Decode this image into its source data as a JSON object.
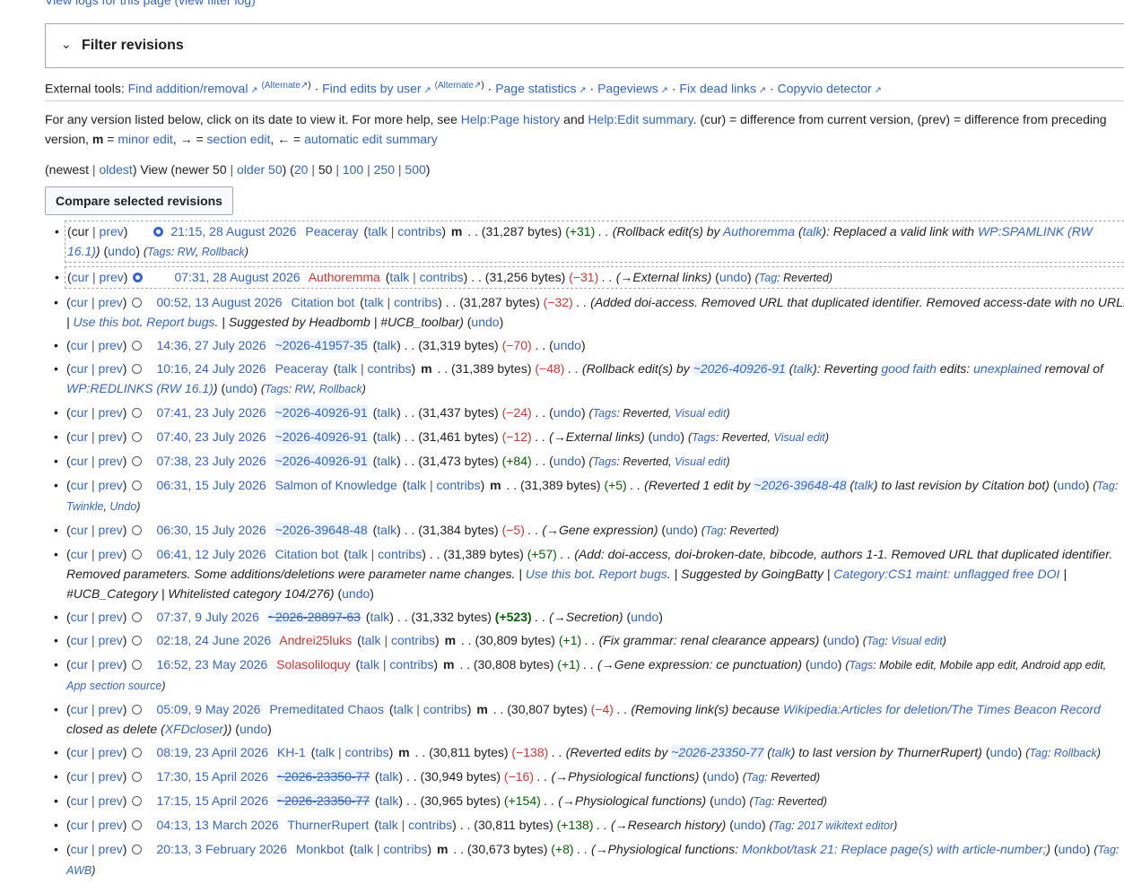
{
  "top_link": "View logs for this page (view filter log)",
  "filter": {
    "chevron": "⌄",
    "title": "Filter revisions"
  },
  "external": {
    "label": "External tools:",
    "find_addition": "Find addition/removal",
    "alternate1": "(Alternate",
    "alternate1_close": ")",
    "find_edits": "Find edits by user",
    "alternate2": "(Alternate",
    "alternate2_close": ")",
    "page_stats": "Page statistics",
    "pageviews": "Pageviews",
    "fix_dead": "Fix dead links",
    "copyvio": "Copyvio detector"
  },
  "help": {
    "t1": "For any version listed below, click on its date to view it. For more help, see ",
    "help_page_history": "Help:Page history",
    "t2": " and ",
    "help_edit_summary": "Help:Edit summary",
    "t3": ". (cur) = difference from current version, (prev) = difference from preceding version, ",
    "m": "m",
    "t4": " = ",
    "minor_edit": "minor edit",
    "t5": ", → = ",
    "section_edit": "section edit",
    "t6": ", ← = ",
    "auto_summary": "automatic edit summary"
  },
  "nav": {
    "newest": "(newest",
    "oldest": "oldest",
    "view": ") View (newer 50",
    "older50": "older 50",
    "close1": ") (",
    "n20": "20",
    "n50": "50",
    "n100": "100",
    "n250": "250",
    "n500": "500",
    "close2": ")"
  },
  "compare_button": "Compare selected revisions",
  "rows": [
    {
      "cur": "cur",
      "prev": "prev",
      "date": "21:15, 28 August 2026",
      "user": "Peaceray",
      "talk": "talk",
      "contribs": "contribs",
      "minor": "m",
      "bytes": ". . (31,287 bytes)",
      "diff": "(+31)",
      "summary": ". . (Rollback edit(s) by ",
      "s_link": "Authoremma",
      "s2": " (",
      "s_talk": "talk",
      "s3": "): Replaced a valid link with ",
      "s_link2": "WP:SPAMLINK (RW 16.1)",
      "s4": ")",
      "undo": "undo",
      "tags_label": "Tags",
      "tag1": "RW",
      "tag2": "Rollback"
    },
    {
      "cur": "cur",
      "prev": "prev",
      "date": "07:31, 28 August 2026",
      "user": "Authoremma",
      "talk": "talk",
      "contribs": "contribs",
      "bytes": ". . (31,256 bytes)",
      "diff": "(−31)",
      "summary": ". . (→External links)",
      "undo": "undo",
      "tags_label": "Tag",
      "tag_plain": "Reverted"
    },
    {
      "cur": "cur",
      "prev": "prev",
      "date": "00:52, 13 August 2026",
      "user": "Citation bot",
      "talk": "talk",
      "contribs": "contribs",
      "bytes": ". . (31,287 bytes)",
      "diff": "(−32)",
      "summary": ". . (Added doi-access. Removed URL that duplicated identifier. Removed access-date with no URL. ",
      "s_bar": "| ",
      "s_link": "Use this bot",
      "s2": ". ",
      "s_link2": "Report bugs",
      "s3": ". | Suggested by Headbomb | #UCB_toolbar)",
      "undo": "undo"
    },
    {
      "cur": "cur",
      "prev": "prev",
      "date": "14:36, 27 July 2026",
      "user": "~2026-41957-35",
      "talk": "talk",
      "bytes": ". . (31,319 bytes)",
      "diff": "(−70)",
      "undo": "undo"
    },
    {
      "cur": "cur",
      "prev": "prev",
      "date": "10:16, 24 July 2026",
      "user": "Peaceray",
      "talk": "talk",
      "contribs": "contribs",
      "minor": "m",
      "bytes": ". . (31,389 bytes)",
      "diff": "(−48)",
      "summary": ". . (Rollback edit(s) by ",
      "s_link": "~2026-40926-91",
      "s2": " (",
      "s_talk": "talk",
      "s3": "): Reverting ",
      "s_link2": "good faith",
      "s4": " edits: ",
      "s_link3": "unexplained",
      "s5": " removal of ",
      "s_link4": "WP:REDLINKS (RW 16.1)",
      "s6": ")",
      "undo": "undo",
      "tags_label": "Tags",
      "tag1": "RW",
      "tag2": "Rollback"
    },
    {
      "cur": "cur",
      "prev": "prev",
      "date": "07:41, 23 July 2026",
      "user": "~2026-40926-91",
      "talk": "talk",
      "bytes": ". . (31,437 bytes)",
      "diff": "(−24)",
      "undo": "undo",
      "tags_label": "Tags",
      "tag_plain": "Reverted",
      "tag1": "Visual edit"
    },
    {
      "cur": "cur",
      "prev": "prev",
      "date": "07:40, 23 July 2026",
      "user": "~2026-40926-91",
      "talk": "talk",
      "bytes": ". . (31,461 bytes)",
      "diff": "(−12)",
      "summary": ". . (→External links)",
      "undo": "undo",
      "tags_label": "Tags",
      "tag_plain": "Reverted",
      "tag1": "Visual edit"
    },
    {
      "cur": "cur",
      "prev": "prev",
      "date": "07:38, 23 July 2026",
      "user": "~2026-40926-91",
      "talk": "talk",
      "bytes": ". . (31,473 bytes)",
      "diff": "(+84)",
      "undo": "undo",
      "tags_label": "Tags",
      "tag_plain": "Reverted",
      "tag1": "Visual edit"
    },
    {
      "cur": "cur",
      "prev": "prev",
      "date": "06:31, 15 July 2026",
      "user": "Salmon of Knowledge",
      "talk": "talk",
      "contribs": "contribs",
      "minor": "m",
      "bytes": ". . (31,389 bytes)",
      "diff": "(+5)",
      "summary": ". . (Reverted 1 edit by ",
      "s_link": "~2026-39648-48",
      "s2": " (",
      "s_talk": "talk",
      "s3": ") to last revision by Citation bot)",
      "undo": "undo",
      "tags_label": "Tag",
      "tag1": "Twinkle",
      "tag2": "Undo"
    },
    {
      "cur": "cur",
      "prev": "prev",
      "date": "06:30, 15 July 2026",
      "user": "~2026-39648-48",
      "talk": "talk",
      "bytes": ". . (31,384 bytes)",
      "diff": "(−5)",
      "summary": ". . (→Gene expression)",
      "undo": "undo",
      "tags_label": "Tag",
      "tag_plain": "Reverted"
    },
    {
      "cur": "cur",
      "prev": "prev",
      "date": "06:41, 12 July 2026",
      "user": "Citation bot",
      "talk": "talk",
      "contribs": "contribs",
      "bytes": ". . (31,389 bytes)",
      "diff": "(+57)",
      "summary": ". . (Add: doi-access, doi-broken-date, bibcode, authors 1-1. Removed URL that duplicated identifier. Removed parameters. Some additions/deletions were parameter name changes. | ",
      "s_link": "Use this bot",
      "s2": ". ",
      "s_link2": "Report bugs",
      "s3": ". | Suggested by GoingBatty | ",
      "s_link3": "Category:CS1 maint: unflagged free DOI",
      "s4": " | #UCB_Category | Whitelisted category 104/276)",
      "undo": "undo"
    },
    {
      "cur": "cur",
      "prev": "prev",
      "date": "07:37, 9 July 2026",
      "user": "~2026-28897-63",
      "talk": "talk",
      "bytes": ". . (31,332 bytes)",
      "diff": "(+523)",
      "summary": ". . (→Secretion)",
      "undo": "undo"
    },
    {
      "cur": "cur",
      "prev": "prev",
      "date": "02:18, 24 June 2026",
      "user": "Andrei25luks",
      "talk": "talk",
      "contribs": "contribs",
      "minor": "m",
      "bytes": ". . (30,809 bytes)",
      "diff": "(+1)",
      "summary": ". . (Fix grammar: renal clearance appears)",
      "undo": "undo",
      "tags_label": "Tag",
      "tag1": "Visual edit"
    },
    {
      "cur": "cur",
      "prev": "prev",
      "date": "16:52, 23 May 2026",
      "user": "Solasoliloquy",
      "talk": "talk",
      "contribs": "contribs",
      "minor": "m",
      "bytes": ". . (30,808 bytes)",
      "diff": "(+1)",
      "summary": ". . (→Gene expression: ce punctuation)",
      "undo": "undo",
      "tags_label": "Tags",
      "tag_plain": "Mobile edit, Mobile app edit, Android app edit, ",
      "tag1": "App section source"
    },
    {
      "cur": "cur",
      "prev": "prev",
      "date": "05:09, 9 May 2026",
      "user": "Premeditated Chaos",
      "talk": "talk",
      "contribs": "contribs",
      "minor": "m",
      "bytes": ". . (30,807 bytes)",
      "diff": "(−4)",
      "summary": ". . (Removing link(s) because ",
      "s_link": "Wikipedia:Articles for deletion/The Times Beacon Record",
      "s2": " closed as delete (",
      "s_link2": "XFDcloser",
      "s3": "))",
      "undo": "undo"
    },
    {
      "cur": "cur",
      "prev": "prev",
      "date": "08:19, 23 April 2026",
      "user": "KH-1",
      "talk": "talk",
      "contribs": "contribs",
      "minor": "m",
      "bytes": ". . (30,811 bytes)",
      "diff": "(−138)",
      "summary": ". . (Reverted edits by ",
      "s_link": "~2026-23350-77",
      "s2": " (",
      "s_talk": "talk",
      "s3": ") to last version by ThurnerRupert)",
      "undo": "undo",
      "tags_label": "Tag",
      "tag1": "Rollback"
    },
    {
      "cur": "cur",
      "prev": "prev",
      "date": "17:30, 15 April 2026",
      "user": "~2026-23350-77",
      "talk": "talk",
      "bytes": ". . (30,949 bytes)",
      "diff": "(−16)",
      "summary": ". . (→Physiological functions)",
      "undo": "undo",
      "tags_label": "Tag",
      "tag_plain": "Reverted"
    },
    {
      "cur": "cur",
      "prev": "prev",
      "date": "17:15, 15 April 2026",
      "user": "~2026-23350-77",
      "talk": "talk",
      "bytes": ". . (30,965 bytes)",
      "diff": "(+154)",
      "summary": ". . (→Physiological functions)",
      "undo": "undo",
      "tags_label": "Tag",
      "tag_plain": "Reverted"
    },
    {
      "cur": "cur",
      "prev": "prev",
      "date": "04:13, 13 March 2026",
      "user": "ThurnerRupert",
      "talk": "talk",
      "contribs": "contribs",
      "bytes": ". . (30,811 bytes)",
      "diff": "(+138)",
      "summary": ". . (→Research history)",
      "undo": "undo",
      "tags_label": "Tag",
      "tag1": "2017 wikitext editor"
    },
    {
      "cur": "cur",
      "prev": "prev",
      "date": "20:13, 3 February 2026",
      "user": "Monkbot",
      "talk": "talk",
      "contribs": "contribs",
      "minor": "m",
      "bytes": ". . (30,673 bytes)",
      "diff": "(+8)",
      "summary": ". . (→Physiological functions: ",
      "s_link": "Monkbot/task 21: Replace page(s) with article-number;",
      "s2": ")",
      "undo": "undo",
      "tags_label": "Tag",
      "tag1": "AWB"
    }
  ]
}
